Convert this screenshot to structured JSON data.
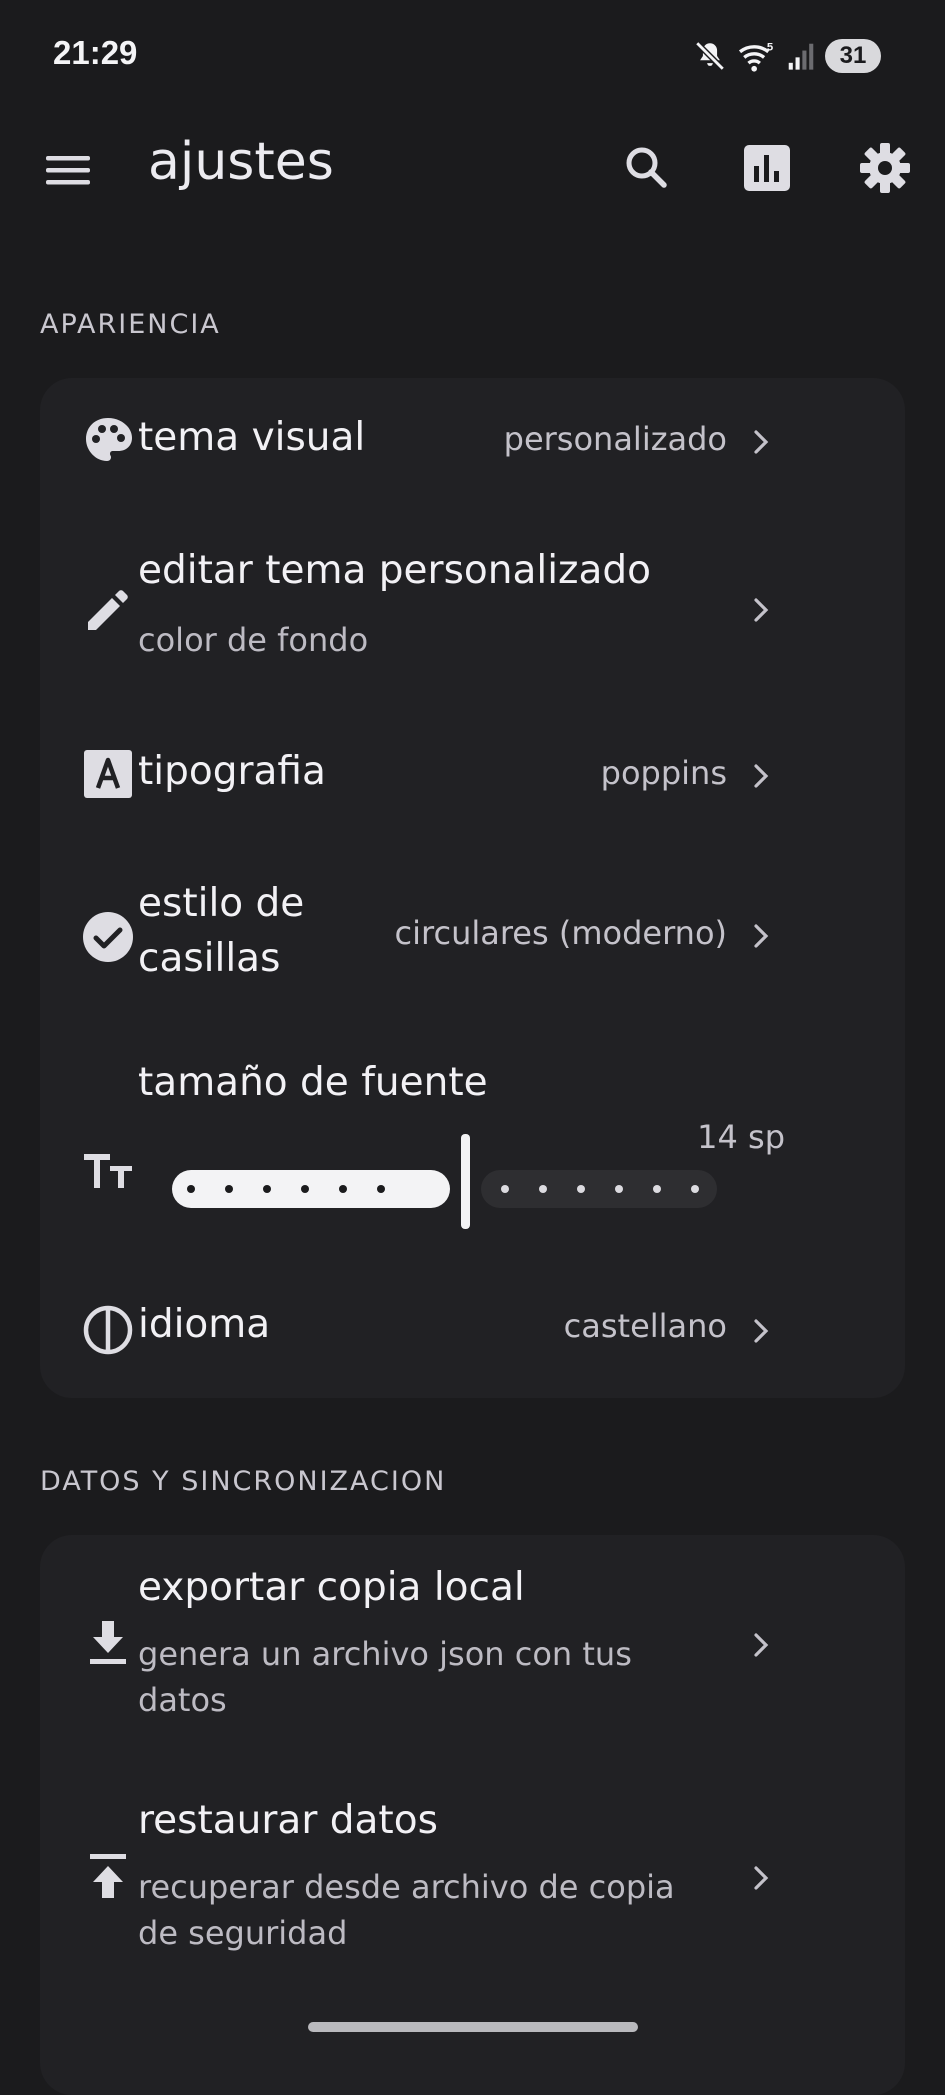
{
  "status_bar": {
    "time": "21:29",
    "battery": "31",
    "icons": [
      "mute-icon",
      "wifi-5g-icon",
      "signal-icon",
      "battery-icon"
    ]
  },
  "app_bar": {
    "title": "ajustes",
    "actions": [
      "search-icon",
      "stats-icon",
      "settings-icon"
    ]
  },
  "sections": {
    "appearance": {
      "header": "APARIENCIA",
      "theme": {
        "title": "tema visual",
        "value": "personalizado",
        "icon": "palette-icon"
      },
      "edit_theme": {
        "title": "editar tema personalizado",
        "subtitle": "color de fondo",
        "icon": "pencil-icon"
      },
      "typography": {
        "title": "tipografia",
        "value": "poppins",
        "icon": "font-a-icon"
      },
      "checkbox_style": {
        "title_line1": "estilo de",
        "title_line2": "casillas",
        "value": "circulares (moderno)",
        "icon": "check-circle-icon"
      },
      "font_size": {
        "title": "tamaño de fuente",
        "value": "14 sp",
        "icon": "text-size-icon",
        "slider_level": 0.5
      },
      "language": {
        "title": "idioma",
        "value": "castellano",
        "icon": "language-icon"
      }
    },
    "data_sync": {
      "header": "DATOS Y SINCRONIZACION",
      "export": {
        "title": "exportar copia local",
        "subtitle_line1": "genera un archivo json con tus",
        "subtitle_line2": "datos",
        "icon": "download-icon"
      },
      "restore": {
        "title": "restaurar datos",
        "subtitle_line1": "recuperar desde archivo de copia",
        "subtitle_line2": "de seguridad",
        "icon": "upload-icon"
      }
    }
  },
  "colors": {
    "background": "#1b1b1d",
    "card": "#212124",
    "text_primary": "#f2f1f5",
    "text_secondary": "#bdbbc3",
    "icon": "#dedde3"
  }
}
